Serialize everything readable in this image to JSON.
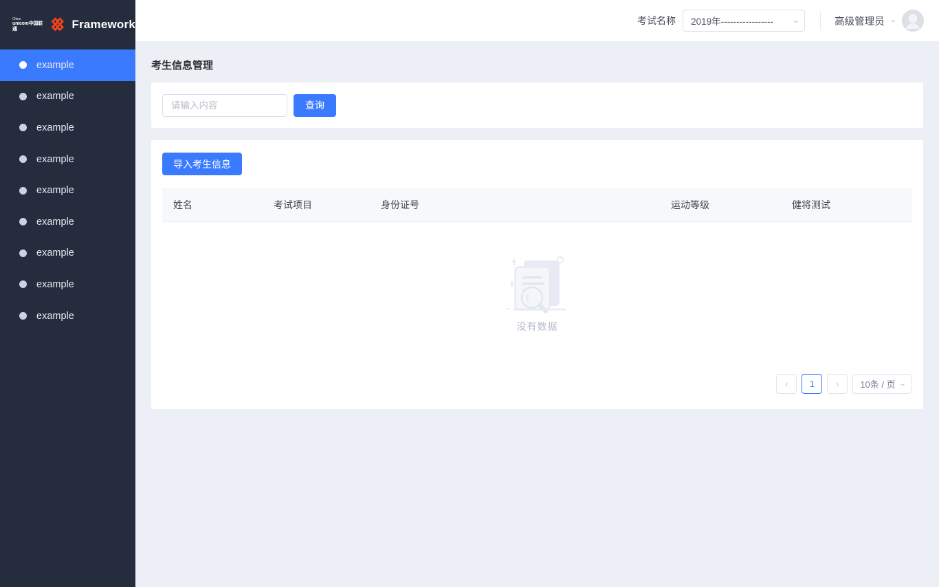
{
  "brand": {
    "logo_cn_line1": "China",
    "logo_cn_line2": "unicom中国联通",
    "name": "Framework"
  },
  "sidebar": {
    "items": [
      {
        "label": "example",
        "icon": "circle-icon",
        "active": true
      },
      {
        "label": "example",
        "icon": "circle-icon",
        "active": false
      },
      {
        "label": "example",
        "icon": "circle-icon",
        "active": false
      },
      {
        "label": "example",
        "icon": "circle-icon",
        "active": false
      },
      {
        "label": "example",
        "icon": "circle-icon",
        "active": false
      },
      {
        "label": "example",
        "icon": "circle-icon",
        "active": false
      },
      {
        "label": "example",
        "icon": "circle-icon",
        "active": false
      },
      {
        "label": "example",
        "icon": "circle-icon",
        "active": false
      },
      {
        "label": "example",
        "icon": "circle-icon",
        "active": false
      }
    ]
  },
  "topbar": {
    "exam_label": "考试名称",
    "exam_select_value": "2019年-----------------",
    "exam_select_icon": "chevron-down-icon",
    "user_name": "高级管理员",
    "user_caret_icon": "chevron-down-icon",
    "avatar_icon": "user-avatar-icon"
  },
  "page": {
    "title": "考生信息管理"
  },
  "search": {
    "placeholder": "请输入内容",
    "value": "",
    "submit_label": "查询"
  },
  "toolbar": {
    "import_label": "导入考生信息"
  },
  "table": {
    "columns": [
      "姓名",
      "考试项目",
      "身份证号",
      "运动等级",
      "健将测试"
    ],
    "rows": [],
    "empty_text": "没有数据",
    "empty_icon": "no-data-illustration"
  },
  "pagination": {
    "prev_label": "‹",
    "prev_icon": "chevron-left-icon",
    "pages": [
      "1"
    ],
    "current_page": "1",
    "next_label": "›",
    "next_icon": "chevron-right-icon",
    "page_size_label": "10条 / 页",
    "page_size_icon": "chevron-down-icon"
  },
  "colors": {
    "accent": "#3a7afe",
    "sidebar_bg": "#242c3e",
    "page_bg": "#ecf0f6",
    "card_bg": "#ffffff",
    "table_head_bg": "#f6f8fb",
    "logo_orange": "#f4431c"
  }
}
